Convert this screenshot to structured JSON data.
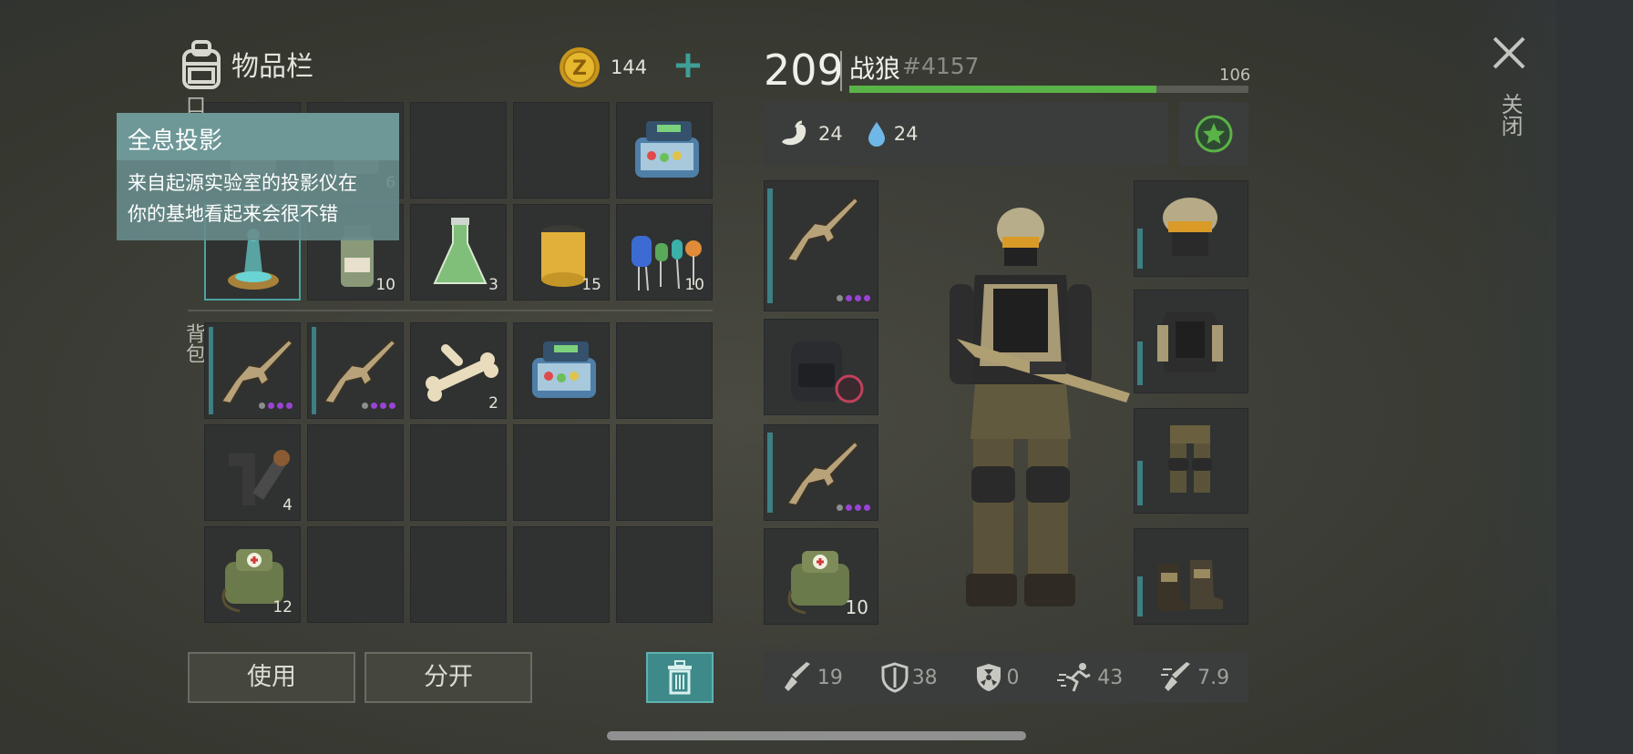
{
  "inventory": {
    "title": "物品栏",
    "coins": "144",
    "pocket_label": "口袋",
    "backpack_label": "背包",
    "pocket": [
      {
        "icon": "unknown-icon",
        "qty": ""
      },
      {
        "icon": "unknown-icon",
        "qty": "6"
      },
      {
        "icon": "empty",
        "qty": ""
      },
      {
        "icon": "empty",
        "qty": ""
      },
      {
        "icon": "electronics-kit-icon",
        "qty": ""
      },
      {
        "icon": "hologram-icon",
        "qty": ""
      },
      {
        "icon": "jar-icon",
        "qty": "10"
      },
      {
        "icon": "flask-icon",
        "qty": "3"
      },
      {
        "icon": "filter-icon",
        "qty": "15"
      },
      {
        "icon": "capacitors-icon",
        "qty": "10"
      }
    ],
    "backpack": [
      {
        "icon": "rifle-icon",
        "qty": ""
      },
      {
        "icon": "rifle-icon",
        "qty": ""
      },
      {
        "icon": "bones-icon",
        "qty": "2"
      },
      {
        "icon": "electronics-kit-icon",
        "qty": ""
      },
      {
        "icon": "empty",
        "qty": ""
      },
      {
        "icon": "pipes-icon",
        "qty": "4"
      },
      {
        "icon": "empty",
        "qty": ""
      },
      {
        "icon": "empty",
        "qty": ""
      },
      {
        "icon": "empty",
        "qty": ""
      },
      {
        "icon": "empty",
        "qty": ""
      },
      {
        "icon": "medkit-bag-icon",
        "qty": "12"
      },
      {
        "icon": "empty",
        "qty": ""
      },
      {
        "icon": "empty",
        "qty": ""
      },
      {
        "icon": "empty",
        "qty": ""
      },
      {
        "icon": "empty",
        "qty": ""
      }
    ],
    "use_label": "使用",
    "split_label": "分开"
  },
  "tooltip": {
    "title": "全息投影",
    "line1": "来自起源实验室的投影仪在",
    "line2": "你的基地看起来会很不错"
  },
  "character": {
    "level": "209",
    "name": "战狼",
    "id": "#4157",
    "xp_value": "106",
    "xp_fraction": 0.77,
    "hunger": "24",
    "thirst": "24",
    "left_slots": [
      {
        "icon": "rifle-icon",
        "qty": ""
      },
      {
        "icon": "backpack-icon",
        "qty": ""
      },
      {
        "icon": "rifle-icon",
        "qty": ""
      },
      {
        "icon": "medkit-bag-icon",
        "qty": "10"
      }
    ],
    "right_slots": [
      "helmet-icon",
      "vest-icon",
      "pants-icon",
      "boots-icon"
    ],
    "stats": {
      "damage": "19",
      "defense": "38",
      "radiation": "0",
      "speed": "43",
      "attack_speed": "7.9"
    }
  },
  "close_label": "关闭",
  "colors": {
    "accent": "#3e9f96",
    "xp": "#5ab347",
    "rarity": "#9a43d4"
  }
}
